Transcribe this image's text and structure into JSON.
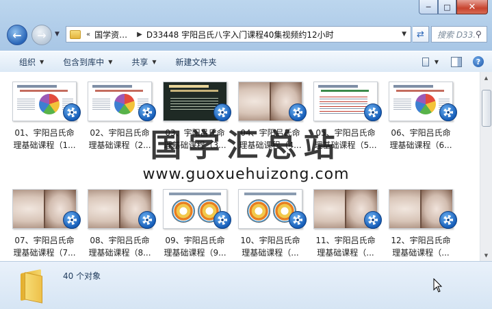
{
  "window": {
    "caption_buttons": {
      "minimize": "─",
      "maximize": "□",
      "close": "✕"
    }
  },
  "navigation": {
    "back_icon": "←",
    "forward_icon": "→",
    "breadcrumb_sep": "«",
    "breadcrumbs": [
      "国学资…",
      "D33448 宇阳吕氏八字入门课程40集视频约12小时"
    ],
    "search_placeholder": "搜索 D33..."
  },
  "toolbar": {
    "organize": "组织",
    "include_library": "包含到库中",
    "share": "共享",
    "new_folder": "新建文件夹"
  },
  "files": [
    {
      "line1": "01、宇阳吕氏命",
      "line2": "理基础课程（1...",
      "thumb": "slide"
    },
    {
      "line1": "02、宇阳吕氏命",
      "line2": "理基础课程（2...",
      "thumb": "slide"
    },
    {
      "line1": "03、宇阳吕氏命",
      "line2": "理基础课程（3...",
      "thumb": "slide3"
    },
    {
      "line1": "04、宇阳吕氏命",
      "line2": "理基础课程（4...",
      "thumb": "paper"
    },
    {
      "line1": "05、宇阳吕氏命",
      "line2": "理基础课程（5...",
      "thumb": "slide2"
    },
    {
      "line1": "06、宇阳吕氏命",
      "line2": "理基础课程（6...",
      "thumb": "slide"
    },
    {
      "line1": "07、宇阳吕氏命",
      "line2": "理基础课程（7...",
      "thumb": "paper"
    },
    {
      "line1": "08、宇阳吕氏命",
      "line2": "理基础课程（8...",
      "thumb": "paper"
    },
    {
      "line1": "09、宇阳吕氏命",
      "line2": "理基础课程（9...",
      "thumb": "wheel"
    },
    {
      "line1": "10、宇阳吕氏命",
      "line2": "理基础课程（...",
      "thumb": "wheel"
    },
    {
      "line1": "11、宇阳吕氏命",
      "line2": "理基础课程（...",
      "thumb": "paper"
    },
    {
      "line1": "12、宇阳吕氏命",
      "line2": "理基础课程（...",
      "thumb": "paper"
    }
  ],
  "status": {
    "item_count": "40 个对象"
  },
  "watermark": {
    "title": "国学汇总站",
    "url": "www.guoxuehuizong.com"
  },
  "colors": {
    "accent": "#1e395b",
    "selection_blue": "#165db8"
  }
}
